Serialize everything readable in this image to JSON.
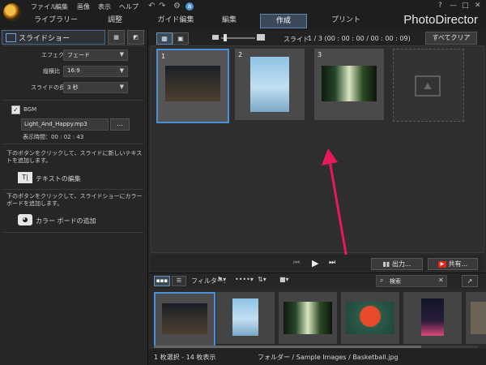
{
  "app": {
    "brand": "PhotoDirector",
    "menu": [
      "ファイル",
      "編集",
      "画像",
      "表示",
      "ヘルプ"
    ],
    "tabs": [
      {
        "label": "ライブラリー"
      },
      {
        "label": "調整"
      },
      {
        "label": "ガイド編集"
      },
      {
        "label": "編集"
      },
      {
        "label": "作成",
        "active": true
      },
      {
        "label": "プリント"
      }
    ],
    "window_buttons": [
      "?",
      "—",
      "□",
      "✕"
    ]
  },
  "left_panel": {
    "title": "スライドショー",
    "effect_label": "エフェクト",
    "effect_value": "フェード",
    "aspect_label": "縦横比",
    "aspect_value": "16:9",
    "length_label": "スライドの長さ",
    "length_value": "3 秒",
    "bgm_label": "BGM",
    "bgm_checked": true,
    "bgm_file": "Light_And_Happy.mp3",
    "bgm_more": "...",
    "play_time": "表示時間：00 : 02 : 43",
    "text_hint": "下のボタンをクリックして、スライドに新しいテキストを追加します。",
    "text_button": "テキストの編集",
    "colorboard_hint": "下のボタンをクリックして、スライドショーにカラー ボードを追加します。",
    "colorboard_button": "カラー ボードの追加"
  },
  "main": {
    "slide_label": "スライド",
    "slide_counter": "1 /  3 (00 : 00 : 00 / 00 : 00 : 09)",
    "clear_all": "すべてクリア",
    "slides": [
      {
        "num": "1",
        "selected": true
      },
      {
        "num": "2",
        "selected": false
      },
      {
        "num": "3",
        "selected": false
      }
    ],
    "output_button": "出力...",
    "share_button": "共有..."
  },
  "library": {
    "filter_label": "フィルター:",
    "search_placeholder": "検索",
    "status_left": "1 枚選択 - 14 枚表示",
    "status_path": "フォルダー / Sample Images / Basketball.jpg"
  },
  "colors": {
    "accent": "#4a90d9",
    "arrow": "#e8195a",
    "share_icon": "#e62117"
  }
}
